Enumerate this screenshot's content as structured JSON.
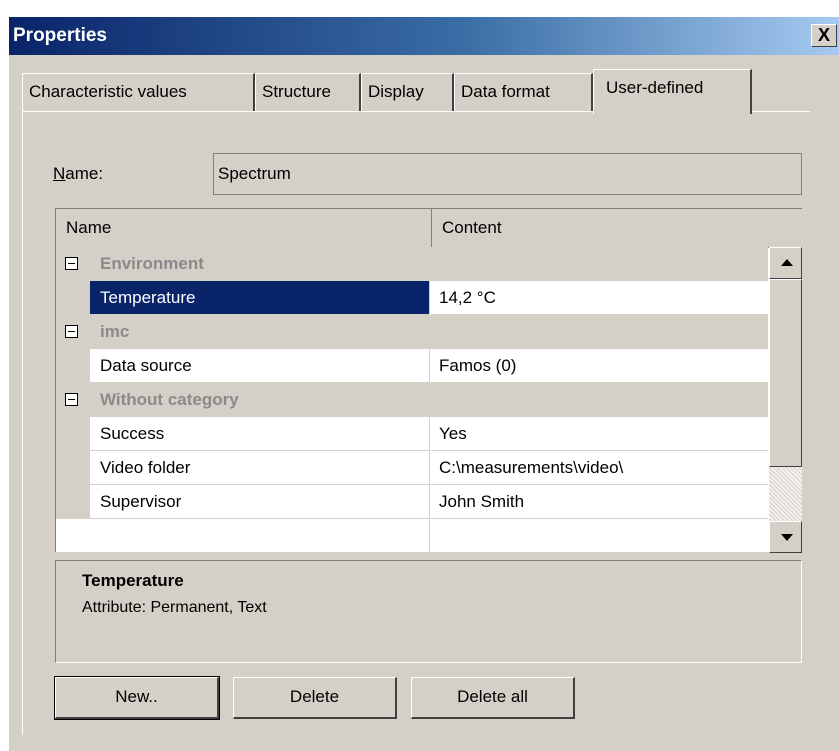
{
  "window": {
    "title": "Properties",
    "close_symbol": "X"
  },
  "tabs": [
    {
      "label": "Characteristic values"
    },
    {
      "label": "Structure"
    },
    {
      "label": "Display"
    },
    {
      "label": "Data format"
    },
    {
      "label": "User-defined",
      "active": true
    }
  ],
  "name_field": {
    "label_accel": "N",
    "label_rest": "ame:",
    "value": "Spectrum"
  },
  "grid": {
    "columns": [
      "Name",
      "Content"
    ],
    "categories": [
      {
        "label": "Environment",
        "rows": [
          {
            "name": "Temperature",
            "content": "14,2 °C",
            "selected": true
          }
        ]
      },
      {
        "label": "imc",
        "rows": [
          {
            "name": "Data source",
            "content": "Famos  (0)"
          }
        ]
      },
      {
        "label": "Without category",
        "rows": [
          {
            "name": "Success",
            "content": "Yes"
          },
          {
            "name": "Video folder",
            "content": "C:\\measurements\\video\\"
          },
          {
            "name": "Supervisor",
            "content": "John Smith"
          }
        ]
      }
    ]
  },
  "description": {
    "title": "Temperature",
    "text": "Attribute: Permanent, Text"
  },
  "buttons": {
    "new": "New..",
    "delete": "Delete",
    "delete_all": "Delete all"
  },
  "colors": {
    "titlebar_start": "#0a246a",
    "selection": "#0a246a",
    "face": "#d4d0c8"
  }
}
